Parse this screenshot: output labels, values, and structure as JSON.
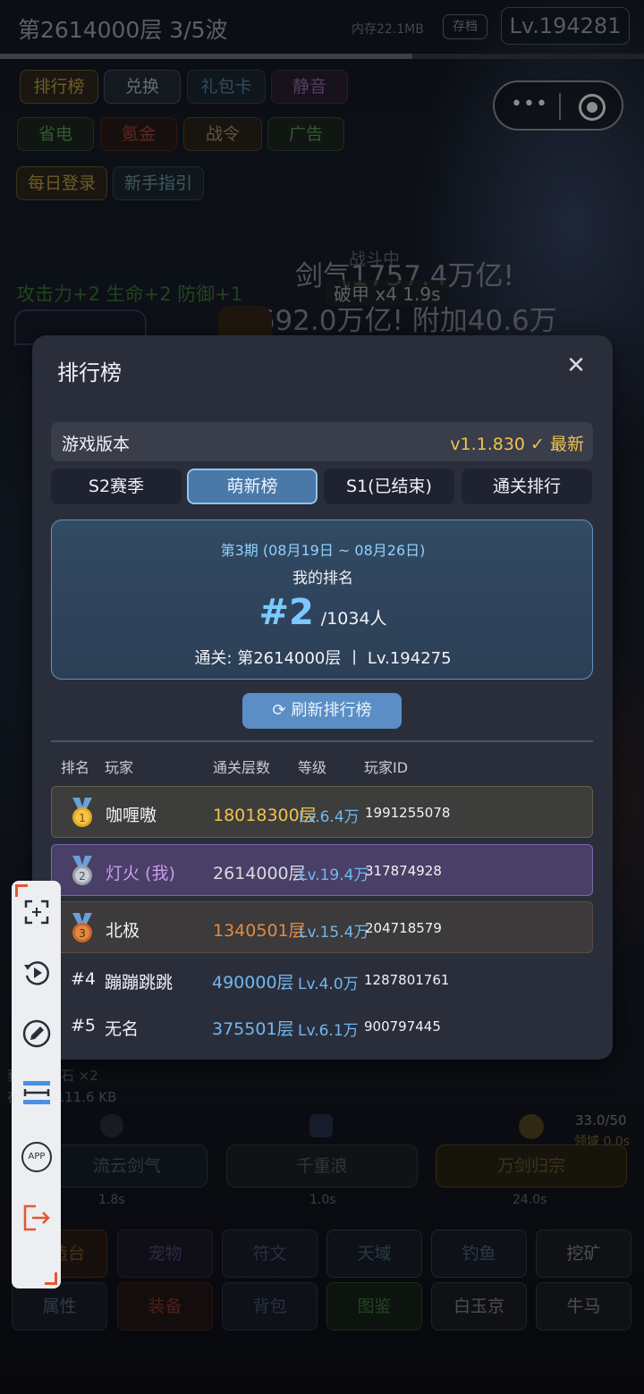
{
  "topbar": {
    "floor_title": "第2614000层  3/5波",
    "memory": "内存22.1MB",
    "save_label": "存档",
    "level": "Lv.194281",
    "progress": 0.64
  },
  "chips": {
    "row1": [
      "排行榜",
      "兑换",
      "礼包卡",
      "静音"
    ],
    "row2": [
      "省电",
      "氪金",
      "战令",
      "广告"
    ],
    "row3": [
      "每日登录",
      "新手指引"
    ]
  },
  "battle_text": {
    "status": "战斗中",
    "sword_qi": "剑气1757.4万亿!",
    "armor_break": "破甲 x4 1.9s",
    "stats": "攻击力+2 生命+2 防御+1",
    "damage": "9692.0万亿! 附加40.6万"
  },
  "modal": {
    "title": "排行榜",
    "version_label": "游戏版本",
    "version_value": "v1.1.830 ✓ 最新",
    "tabs": [
      "S2赛季",
      "萌新榜",
      "S1(已结束)",
      "通关排行"
    ],
    "active_tab": 1,
    "period": "第3期 (08月19日 ~ 08月26日)",
    "my_rank_label": "我的排名",
    "my_rank": "#2",
    "total": "/1034人",
    "clear_info": "通关: 第2614000层  丨  Lv.194275",
    "refresh_label": "刷新排行榜",
    "headers": [
      "排名",
      "玩家",
      "通关层数",
      "等级",
      "玩家ID"
    ],
    "rows": [
      {
        "rank": "1",
        "name": "咖喱嗷",
        "floor": "18018300层",
        "level": "Lv.6.4万",
        "id": "1991255078"
      },
      {
        "rank": "2",
        "name": "灯火 (我)",
        "floor": "2614000层",
        "level": "Lv.19.4万",
        "id": "317874928"
      },
      {
        "rank": "3",
        "name": "北极",
        "floor": "1340501层",
        "level": "Lv.15.4万",
        "id": "204718579"
      },
      {
        "rank": "#4",
        "name": "蹦蹦跳跳",
        "floor": "490000层",
        "level": "Lv.4.0万",
        "id": "1287801761"
      },
      {
        "rank": "#5",
        "name": "无名",
        "floor": "375501层",
        "level": "Lv.6.1万",
        "id": "900797445"
      }
    ]
  },
  "log": {
    "line1": "获得甩锅石 ×2",
    "line2": "存档 A: 111.6 KB"
  },
  "skills": {
    "energy": "33.0/50",
    "domain": "领域 0.0s",
    "items": [
      {
        "name": "流云剑气",
        "time": "1.8s"
      },
      {
        "name": "千重浪",
        "time": "1.0s"
      },
      {
        "name": "万剑归宗",
        "time": "24.0s"
      }
    ]
  },
  "nav": {
    "row1": [
      "锻造台",
      "宠物",
      "符文",
      "天域",
      "钓鱼",
      "挖矿"
    ],
    "row2": [
      "属性",
      "装备",
      "背包",
      "图鉴",
      "白玉京",
      "牛马"
    ]
  },
  "toolbar": {
    "icons": [
      "fullscreen-icon",
      "replay-icon",
      "edit-icon",
      "resize-icon",
      "app-icon",
      "exit-icon"
    ],
    "app_label": "APP"
  }
}
